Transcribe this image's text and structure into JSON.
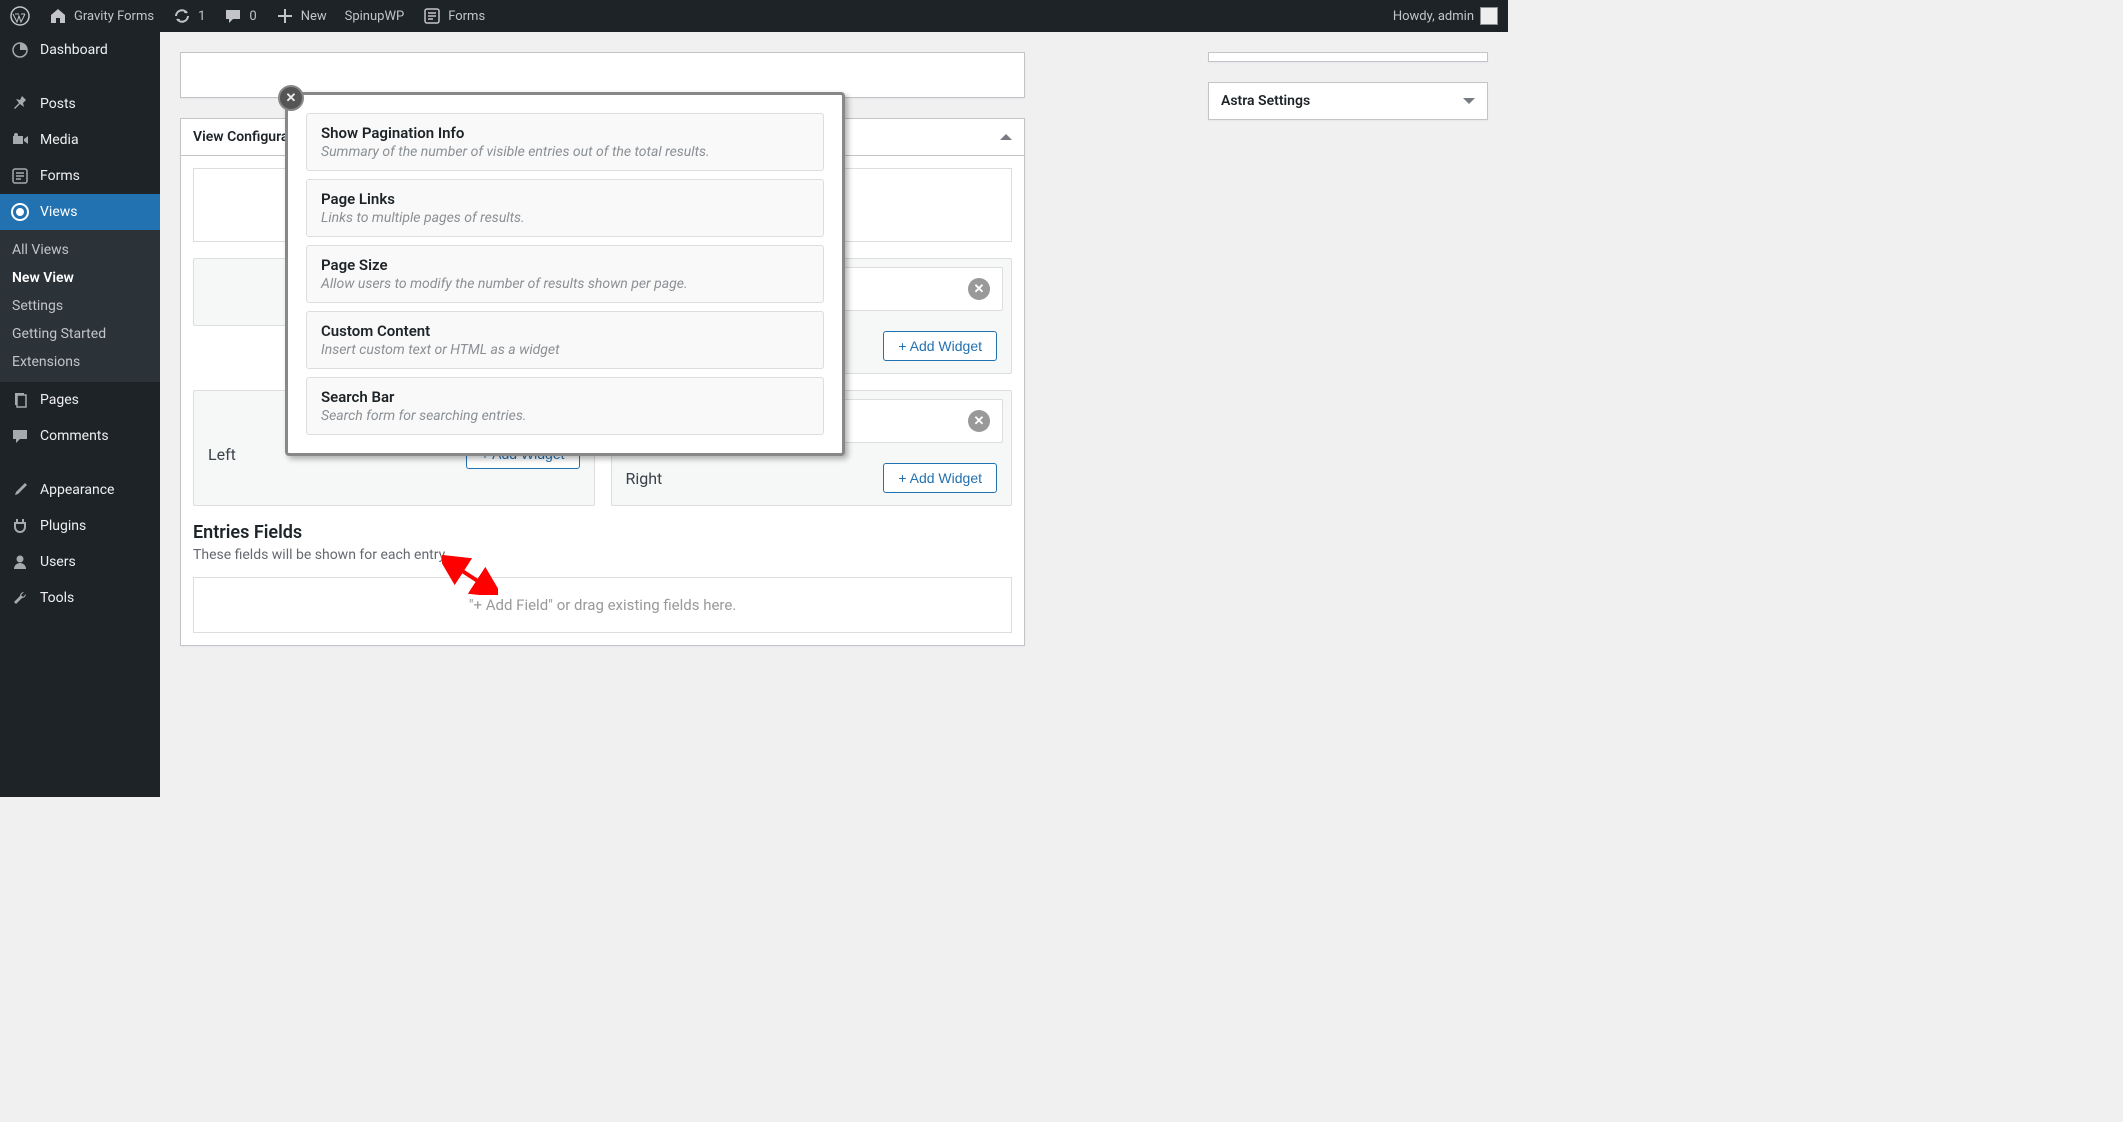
{
  "adminbar": {
    "site_title": "Gravity Forms",
    "updates_count": "1",
    "comments_count": "0",
    "new_label": "New",
    "spinupwp": "SpinupWP",
    "forms_label": "Forms",
    "howdy": "Howdy, admin"
  },
  "sidebar": {
    "dashboard": "Dashboard",
    "posts": "Posts",
    "media": "Media",
    "forms": "Forms",
    "views": "Views",
    "pages": "Pages",
    "comments": "Comments",
    "appearance": "Appearance",
    "plugins": "Plugins",
    "users": "Users",
    "tools": "Tools",
    "submenu": {
      "all_views": "All Views",
      "new_view": "New View",
      "settings": "Settings",
      "getting_started": "Getting Started",
      "extensions": "Extensions"
    }
  },
  "main": {
    "view_config_title": "View Configuration",
    "left_label": "Left",
    "right_label": "Right",
    "add_widget": "+ Add Widget",
    "entries_title": "Entries Fields",
    "entries_desc": "These fields will be shown for each entry.",
    "entries_placeholder": "\"+ Add Field\" or drag existing fields here."
  },
  "side": {
    "astra_title": "Astra Settings"
  },
  "modal": {
    "opts": [
      {
        "title": "Show Pagination Info",
        "desc": "Summary of the number of visible entries out of the total results."
      },
      {
        "title": "Page Links",
        "desc": "Links to multiple pages of results."
      },
      {
        "title": "Page Size",
        "desc": "Allow users to modify the number of results shown per page."
      },
      {
        "title": "Custom Content",
        "desc": "Insert custom text or HTML as a widget"
      },
      {
        "title": "Search Bar",
        "desc": "Search form for searching entries."
      }
    ]
  }
}
